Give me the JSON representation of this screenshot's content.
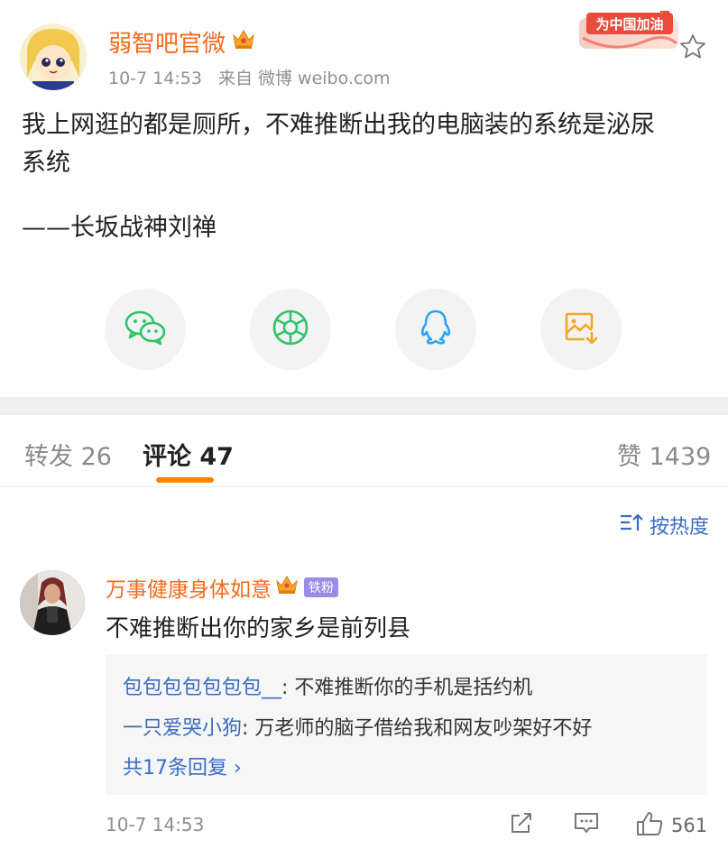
{
  "post": {
    "author": "弱智吧官微",
    "time": "10-7 14:53",
    "source": "来自 微博 weibo.com",
    "badge": "为中国加油",
    "content_line1": "我上网逛的都是厕所，不难推断出我的电脑装的系统是泌尿",
    "content_line2": "系统",
    "content_sign": "——长坂战神刘禅"
  },
  "share": {
    "icons": [
      "wechat-icon",
      "moments-icon",
      "qq-icon",
      "save-image-icon"
    ]
  },
  "tabs": {
    "repost": "转发 26",
    "comments": "评论 47",
    "likes": "赞 1439"
  },
  "sort": {
    "label": "按热度"
  },
  "comment": {
    "author": "万事健康身体如意",
    "fan_badge": "铁粉",
    "text": "不难推断出你的家乡是前列县",
    "replies": [
      {
        "user": "包包包包包包包__",
        "sep": ": ",
        "text": "不难推断你的手机是括约机"
      },
      {
        "user": "一只爱哭小狗",
        "sep": ": ",
        "text": "万老师的脑子借给我和网友吵架好不好"
      }
    ],
    "more_replies": "共17条回复 ›",
    "time": "10-7 14:53",
    "likes": "561"
  },
  "colors": {
    "accent_orange": "#ff8200",
    "name_orange": "#f26b1d",
    "link_blue": "#3a6cc0",
    "wechat_green": "#2fc36a",
    "qq_blue": "#2aa4f4"
  }
}
